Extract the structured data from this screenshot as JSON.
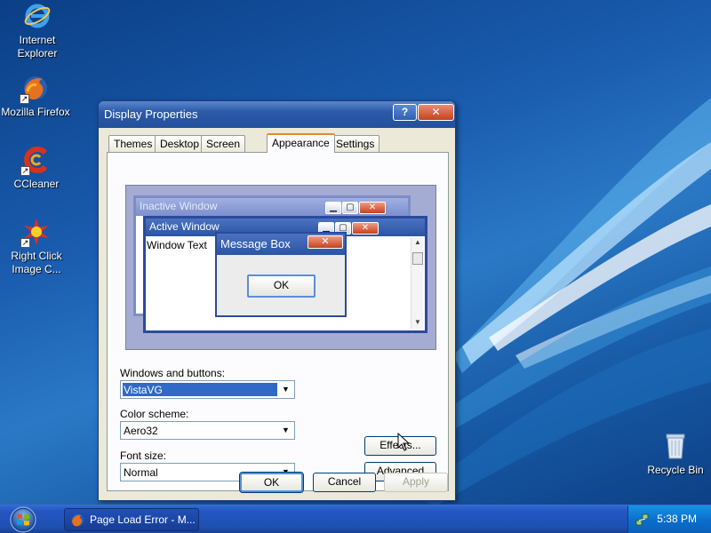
{
  "desktop": {
    "icons": [
      {
        "label": "Internet Explorer",
        "icon": "internet-explorer-icon"
      },
      {
        "label": "Mozilla Firefox",
        "icon": "firefox-icon"
      },
      {
        "label": "CCleaner",
        "icon": "ccleaner-icon"
      },
      {
        "label": "Right Click Image C...",
        "icon": "right-click-image-converter-icon"
      },
      {
        "label": "Recycle Bin",
        "icon": "recycle-bin-icon"
      }
    ]
  },
  "dialog": {
    "title": "Display Properties",
    "help_glyph": "?",
    "close_glyph": "✕",
    "tabs": [
      "Themes",
      "Desktop",
      "Screen Saver",
      "Appearance",
      "Settings"
    ],
    "active_tab": "Appearance",
    "preview": {
      "inactive_title": "Inactive Window",
      "active_title": "Active Window",
      "window_text": "Window Text",
      "message_title": "Message Box",
      "message_ok": "OK"
    },
    "windows_buttons_label": "Windows and buttons:",
    "windows_buttons_value": "VistaVG",
    "color_scheme_label": "Color scheme:",
    "color_scheme_value": "Aero32",
    "font_size_label": "Font size:",
    "font_size_value": "Normal",
    "effects_button": "Effects...",
    "advanced_button": "Advanced",
    "ok_button": "OK",
    "cancel_button": "Cancel",
    "apply_button": "Apply"
  },
  "taskbar": {
    "task_label": "Page Load Error - M...",
    "clock": "5:38 PM"
  },
  "colors": {
    "titlebar": "#2c5aa8",
    "tab_highlight": "#e68b2c",
    "selection": "#3169c6",
    "close_button": "#c4431f"
  }
}
